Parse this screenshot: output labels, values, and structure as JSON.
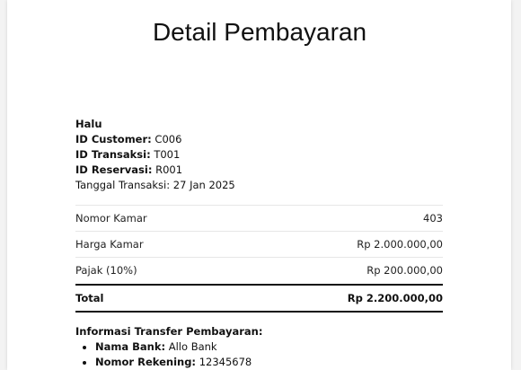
{
  "page": {
    "title": "Detail Pembayaran"
  },
  "customer": {
    "name": "Halu",
    "id_customer_label": "ID Customer:",
    "id_customer": "C006",
    "id_transaksi_label": "ID Transaksi:",
    "id_transaksi": "T001",
    "id_reservasi_label": "ID Reservasi:",
    "id_reservasi": "R001",
    "tanggal_label": "Tanggal Transaksi:",
    "tanggal": "27 Jan 2025"
  },
  "details": {
    "rows": [
      {
        "label": "Nomor Kamar",
        "value": "403"
      },
      {
        "label": "Harga Kamar",
        "value": "Rp 2.000.000,00"
      },
      {
        "label": "Pajak (10%)",
        "value": "Rp 200.000,00"
      }
    ],
    "total_label": "Total",
    "total_value": "Rp 2.200.000,00"
  },
  "transfer": {
    "heading": "Informasi Transfer Pembayaran:",
    "items": [
      {
        "label": "Nama Bank:",
        "value": "Allo Bank"
      },
      {
        "label": "Nomor Rekening:",
        "value": "12345678"
      }
    ]
  }
}
